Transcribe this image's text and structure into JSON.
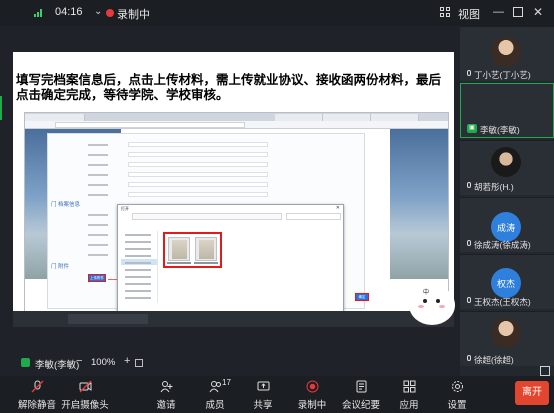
{
  "topbar": {
    "time": "04:16",
    "recording_label": "录制中",
    "view_label": "视图"
  },
  "share": {
    "caption": "填写完档案信息后，点击上传材料，需上传就业协议、接收函两份材料，最后点击确定完成，等待学院、学校审核。",
    "section_label_1": "门 档案信息",
    "section_label_2": "门 附件",
    "upload_button": "上传附件",
    "confirm_button": "确定",
    "dialog": {
      "title": "打开",
      "filename_label": "文件名(N):",
      "open_button": "打开",
      "cancel_button": "取消"
    }
  },
  "sticker": {
    "text": "中"
  },
  "speaker": {
    "name": "李敏(李敏)",
    "zoom": "100%"
  },
  "participants": [
    {
      "name": "丁小艺(丁小艺)",
      "avatar": "photo"
    },
    {
      "name": "李敏(李敏)",
      "avatar": "none",
      "sharing": true
    },
    {
      "name": "胡若彤(H.)",
      "avatar": "photo"
    },
    {
      "name": "徐成涛(徐成涛)",
      "avatar": "成涛"
    },
    {
      "name": "王权杰(王权杰)",
      "avatar": "权杰"
    },
    {
      "name": "徐超(徐超)",
      "avatar": "photo"
    }
  ],
  "colors": {
    "accent_green": "#1faa4b",
    "record_red": "#e23b3b",
    "avatar_blue": "#2f7fdc",
    "highlight_red": "#e01b1b",
    "end_button": "#e2462f"
  },
  "toolbar": {
    "items": [
      {
        "label": "解除静音",
        "icon": "mic-muted-icon"
      },
      {
        "label": "开启摄像头",
        "icon": "camera-off-icon"
      },
      {
        "label": "邀请",
        "icon": "invite-icon"
      },
      {
        "label": "成员",
        "icon": "members-icon",
        "count": "17"
      },
      {
        "label": "共享",
        "icon": "share-screen-icon"
      },
      {
        "label": "录制中",
        "icon": "record-icon"
      },
      {
        "label": "会议纪要",
        "icon": "minutes-icon"
      },
      {
        "label": "应用",
        "icon": "apps-icon"
      },
      {
        "label": "设置",
        "icon": "settings-icon"
      }
    ],
    "end_label": "离开"
  }
}
